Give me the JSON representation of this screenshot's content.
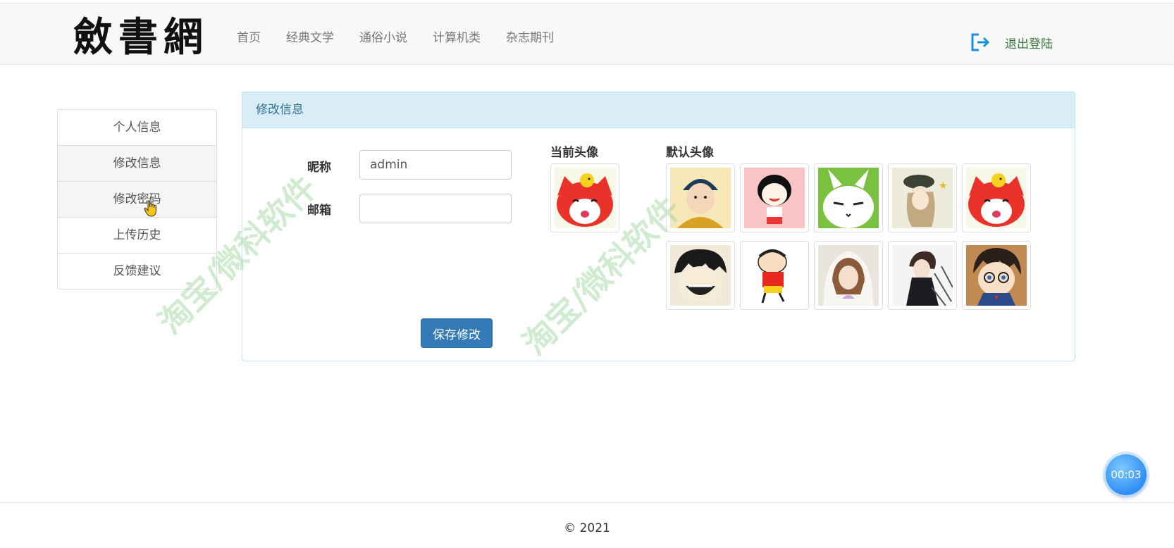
{
  "header": {
    "logo_text": "斂書網",
    "nav": [
      "首页",
      "经典文学",
      "通俗小说",
      "计算机类",
      "杂志期刊"
    ],
    "logout_label": "退出登陆",
    "logout_icon": "logout-icon"
  },
  "sidebar": {
    "items": [
      {
        "label": "个人信息",
        "active": false
      },
      {
        "label": "修改信息",
        "active": true
      },
      {
        "label": "修改密码",
        "active": false
      },
      {
        "label": "上传历史",
        "active": false
      },
      {
        "label": "反馈建议",
        "active": false
      }
    ]
  },
  "panel": {
    "title": "修改信息",
    "nickname_label": "昵称",
    "nickname_value": "admin",
    "email_label": "邮箱",
    "email_value": "",
    "save_label": "保存修改",
    "current_avatar_title": "当前头像",
    "default_avatar_title": "默认头像",
    "current_avatar": "fox-cartoon-avatar",
    "default_avatars": [
      "scholar-boy-avatar",
      "girl-cartoon-avatar",
      "rabbit-cartoon-avatar",
      "hat-girl-avatar",
      "fox-cartoon-avatar",
      "pirate-boy-avatar",
      "crayon-boy-avatar",
      "hoodie-girl-avatar",
      "dark-hair-boy-avatar",
      "detective-boy-avatar"
    ]
  },
  "footer": {
    "copyright": "© 2021"
  },
  "timer": {
    "value": "00:03"
  },
  "watermark": {
    "text": "淘宝/微科软件"
  },
  "colors": {
    "primary": "#337ab7",
    "panel_heading_bg": "#d9edf7",
    "panel_heading_text": "#31708f",
    "logout_text": "#3c763d",
    "logout_icon": "#1b8fd9"
  }
}
